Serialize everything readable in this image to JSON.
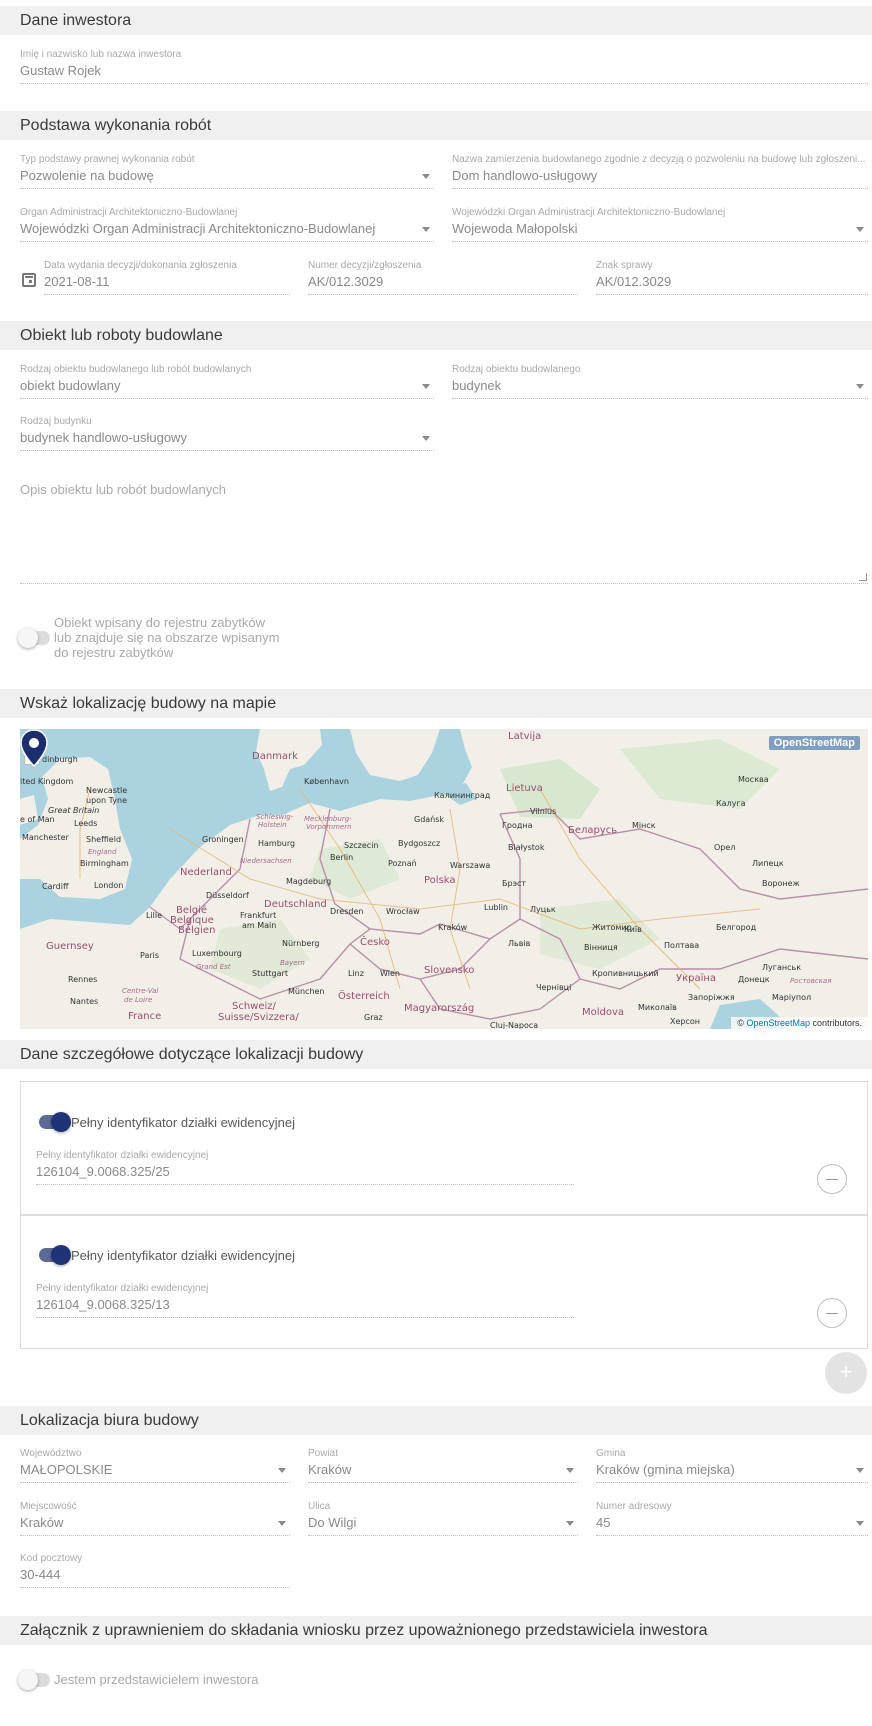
{
  "investor": {
    "header": "Dane inwestora",
    "name_label": "Imię i nazwisko lub nazwa inwestora",
    "name_value": "Gustaw Rojek"
  },
  "basis": {
    "header": "Podstawa wykonania robót",
    "type_label": "Typ podstawy prawnej wykonania robót",
    "type_value": "Pozwolenie na budowę",
    "project_label": "Nazwa zamierzenia budowlanego zgodnie z decyzją o pozwoleniu na budowę lub zgłoszeni...",
    "project_value": "Dom handlowo-usługowy",
    "organ_label": "Organ Administracji Architektoniczno-Budowlanej",
    "organ_value": "Wojewódzki Organ Administracji Architektoniczno-Budowlanej",
    "voiv_organ_label": "Wojewódzki Organ Administracji Architektoniczno-Budowlanej",
    "voiv_organ_value": "Wojewoda Małopolski",
    "date_label": "Data wydania decyzji/dokonania zgłoszenia",
    "date_value": "2021-08-11",
    "decision_label": "Numer decyzji/zgłoszenia",
    "decision_value": "AK/012.3029",
    "case_label": "Znak sprawy",
    "case_value": "AK/012.3029"
  },
  "building": {
    "header": "Obiekt lub roboty budowlane",
    "kind_label": "Rodzaj obiektu budowlanego lub robót budowlanych",
    "kind_value": "obiekt budowlany",
    "object_label": "Rodzaj obiektu budowlanego",
    "object_value": "budynek",
    "btype_label": "Rodzaj budynku",
    "btype_value": "budynek handlowo-usługowy",
    "description_placeholder": "Opis obiektu lub robót budowlanych",
    "monument_toggle_label_1": "Obiekt wpisany do rejestru zabytków",
    "monument_toggle_label_2": "lub znajduje się na obszarze wpisanym",
    "monument_toggle_label_3": "do rejestru zabytków"
  },
  "map": {
    "header": "Wskaż lokalizację budowy na mapie",
    "zoom_in": "+",
    "zoom_out": "−",
    "badge": "OpenStreetMap",
    "attribution_prefix": "© ",
    "attribution_link": "OpenStreetMap",
    "attribution_suffix": " contributors.",
    "labels": {
      "latvija": "Latvija",
      "danmark": "Danmark",
      "edinburgh": "dinburgh",
      "kingdom": "ited Kingdom",
      "newcastle": "Newcastle",
      "upon_tyne": "upon Tyne",
      "great_britain": "Great Britain",
      "isle_of_man": "e of Man",
      "leeds": "Leeds",
      "manchester": "Manchester",
      "sheffield": "Sheffield",
      "england": "England",
      "birmingham": "Birmingham",
      "cardiff": "Cardiff",
      "london": "London",
      "kobenhavn": "København",
      "kaliningrad": "Калининград",
      "lietuva": "Lietuva",
      "vilnius": "Vilnius",
      "moskva": "Москва",
      "kaluga": "Калуга",
      "gdansk": "Gdańsk",
      "grodno": "Гродна",
      "belarus": "Беларусь",
      "minsk": "Мінск",
      "groningen": "Groningen",
      "hamburg": "Hamburg",
      "szczecin": "Szczecin",
      "bydgoszcz": "Bydgoszcz",
      "bialystok": "Białystok",
      "orel": "Орел",
      "nederland": "Nederland",
      "berlin": "Berlin",
      "poznan": "Poznań",
      "warszawa": "Warszawa",
      "lipeck": "Липецк",
      "magdeburg": "Magdeburg",
      "polska": "Polska",
      "brest": "Брэст",
      "voronezh": "Воронеж",
      "dusseldorf": "Düsseldorf",
      "deutschland": "Deutschland",
      "lille": "Lille",
      "belgie": "België",
      "belgique": "Belgique",
      "belgien": "Belgien",
      "frankfurt": "Frankfurt",
      "am_main": "am Main",
      "dresden": "Dresden",
      "wroclaw": "Wrocław",
      "lublin": "Lublin",
      "luck": "Луцьк",
      "zhytomyr": "Житомир",
      "kyiv": "Київ",
      "belgorod": "Белгород",
      "guernsey": "Guernsey",
      "paris": "Paris",
      "luxembourg": "Luxembourg",
      "nurnberg": "Nürnberg",
      "cesko": "Česko",
      "krakow": "Kraków",
      "lviv": "Львів",
      "vinnytsia": "Вінниця",
      "poltava": "Полтава",
      "rennes": "Rennes",
      "stuttgart": "Stuttgart",
      "linz": "Linz",
      "wien": "Wien",
      "slovensko": "Slovensko",
      "kropyvnytskyi": "Кропивницький",
      "ukraina": "Україна",
      "donetsk": "Донецк",
      "luhansk": "Луганськ",
      "nantes": "Nantes",
      "munchen": "München",
      "osterreich": "Österreich",
      "chernivtsi": "Чернівці",
      "zaporizhzhia": "Запоріжжя",
      "france": "France",
      "schweiz": "Schweiz/",
      "suisse": "Suisse/Svizzera/",
      "graz": "Graz",
      "magyarorszag": "Magyarország",
      "moldova": "Moldova",
      "mykolaiv": "Миколаїв",
      "kherson": "Херсон",
      "cluj": "Cluj-Napoca",
      "rostov": "Ростовская",
      "schleswig": "Schleswig-",
      "holstein": "Holstein",
      "mecklenburg": "Mecklenburg-",
      "vorpommern": "Vorpommern",
      "niedersachsen": "Niedersachsen",
      "bayern": "Bayern",
      "grand_est": "Grand Est",
      "centre": "Centre-Val",
      "de_loire": "de Loire",
      "mariupol": "Марiупол"
    }
  },
  "parcels": {
    "header": "Dane szczegółowe dotyczące lokalizacji budowy",
    "items": [
      {
        "toggle_label": "Pełny identyfikator działki ewidencyjnej",
        "field_label": "Pełny identyfikator działki ewidencyjnej",
        "value": "126104_9.0068.325/25"
      },
      {
        "toggle_label": "Pełny identyfikator działki ewidencyjnej",
        "field_label": "Pełny identyfikator działki ewidencyjnej",
        "value": "126104_9.0068.325/13"
      }
    ],
    "add_symbol": "+"
  },
  "office": {
    "header": "Lokalizacja biura budowy",
    "voivodeship_label": "Województwo",
    "voivodeship_value": "MAŁOPOLSKIE",
    "county_label": "Powiat",
    "county_value": "Kraków",
    "commune_label": "Gmina",
    "commune_value": "Kraków (gmina miejska)",
    "city_label": "Miejscowość",
    "city_value": "Kraków",
    "street_label": "Ulica",
    "street_value": "Do Wilgi",
    "number_label": "Numer adresowy",
    "number_value": "45",
    "postal_label": "Kod pocztowy",
    "postal_value": "30-444"
  },
  "attachment": {
    "header": "Załącznik z uprawnieniem do składania wniosku przez upoważnionego przedstawiciela inwestora",
    "toggle_label": "Jestem przedstawicielem inwestora"
  },
  "colors": {
    "header_bg": "#f0f0f0",
    "toggle_on": "#1f3476",
    "map_water": "#aad3df",
    "map_land": "#f2efe9",
    "pin": "#1b2f6e"
  }
}
